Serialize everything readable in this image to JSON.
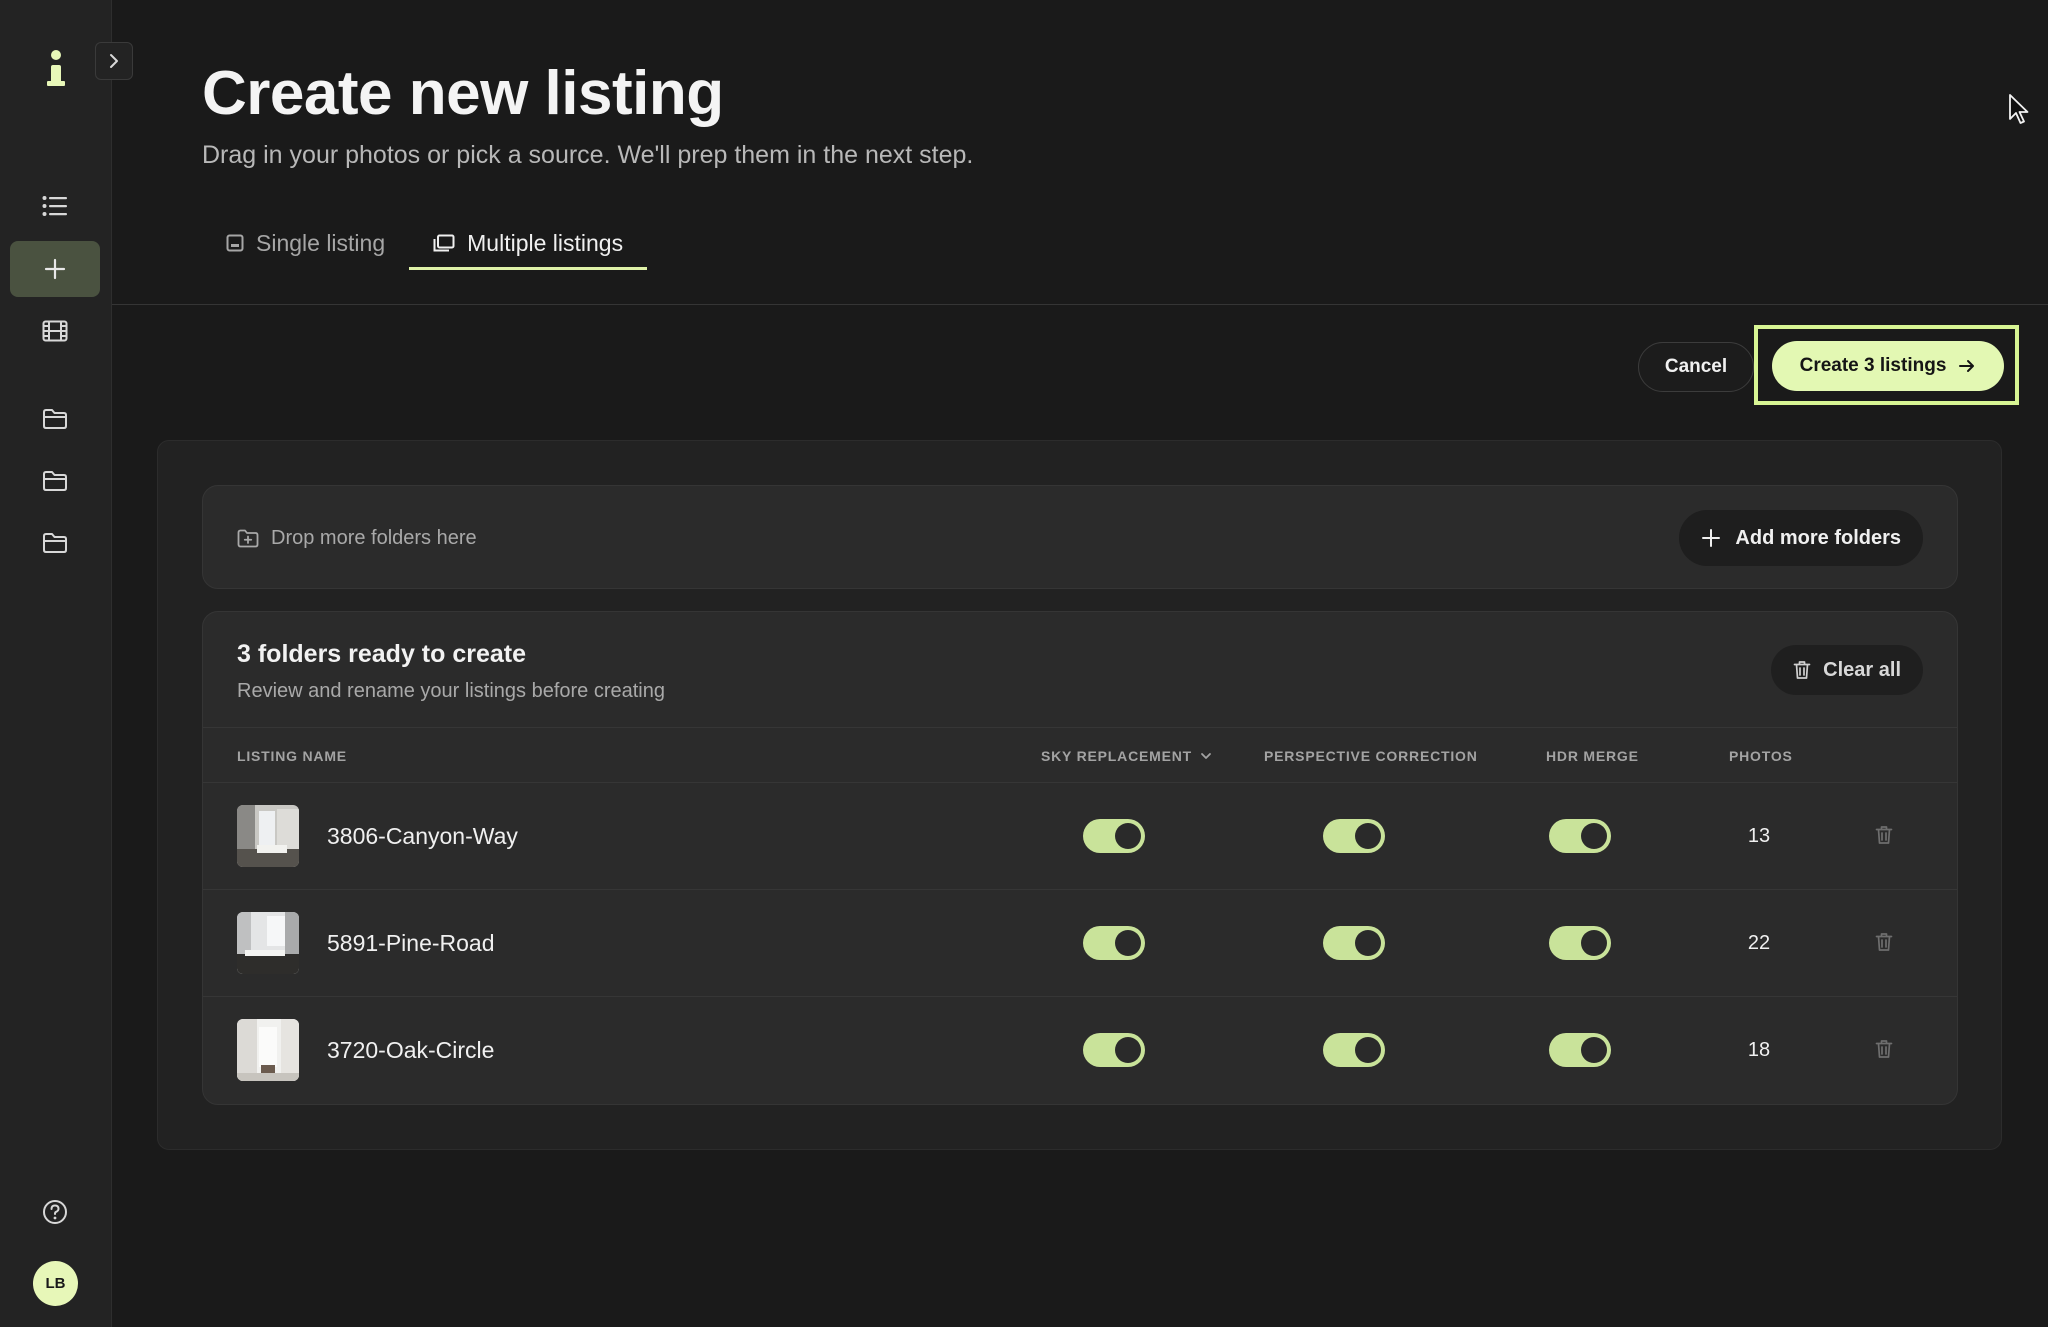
{
  "sidebar": {
    "avatar_initials": "LB",
    "items": [
      {
        "icon": "list-icon"
      },
      {
        "icon": "plus-icon",
        "active": true
      },
      {
        "icon": "film-icon"
      },
      {
        "icon": "folder-icon"
      },
      {
        "icon": "folder-icon"
      },
      {
        "icon": "folder-icon"
      },
      {
        "icon": "help-icon"
      }
    ]
  },
  "header": {
    "title": "Create new listing",
    "subtitle": "Drag in your photos or pick a source. We'll prep them in the next step.",
    "tabs": [
      {
        "label": "Single listing",
        "active": false
      },
      {
        "label": "Multiple listings",
        "active": true
      }
    ]
  },
  "actions": {
    "cancel_label": "Cancel",
    "create_label": "Create 3 listings"
  },
  "dropzone": {
    "label": "Drop more folders here",
    "add_label": "Add more folders"
  },
  "list": {
    "title": "3 folders ready to create",
    "subtitle": "Review and rename your listings before creating",
    "clear_label": "Clear all",
    "columns": {
      "name": "LISTING NAME",
      "sky": "SKY REPLACEMENT",
      "perspective": "PERSPECTIVE CORRECTION",
      "hdr": "HDR MERGE",
      "photos": "PHOTOS"
    },
    "rows": [
      {
        "name": "3806-Canyon-Way",
        "sky": true,
        "perspective": true,
        "hdr": true,
        "photos": "13"
      },
      {
        "name": "5891-Pine-Road",
        "sky": true,
        "perspective": true,
        "hdr": true,
        "photos": "22"
      },
      {
        "name": "3720-Oak-Circle",
        "sky": true,
        "perspective": true,
        "hdr": true,
        "photos": "18"
      }
    ]
  },
  "colors": {
    "accent": "#e3f8b3",
    "toggle_on": "#c9e39a",
    "background": "#1a1a1a",
    "sidebar_active": "#4a5240"
  }
}
